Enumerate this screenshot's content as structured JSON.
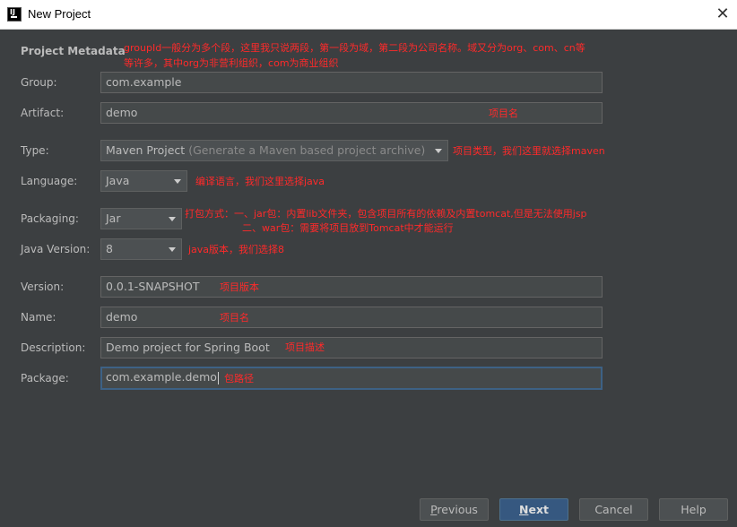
{
  "window": {
    "title": "New Project",
    "close_glyph": "✕"
  },
  "section_title": "Project Metadata",
  "fields": {
    "group": {
      "label": "Group:",
      "value": "com.example"
    },
    "artifact": {
      "label": "Artifact:",
      "value": "demo"
    },
    "type": {
      "label": "Type:",
      "value": "Maven Project",
      "hint": "(Generate a Maven based project archive)"
    },
    "language": {
      "label": "Language:",
      "value": "Java"
    },
    "packaging": {
      "label": "Packaging:",
      "value": "Jar"
    },
    "java_version": {
      "label": "Java Version:",
      "value": "8"
    },
    "version": {
      "label": "Version:",
      "value": "0.0.1-SNAPSHOT"
    },
    "name": {
      "label": "Name:",
      "value": "demo"
    },
    "description": {
      "label": "Description:",
      "value": "Demo project for Spring Boot"
    },
    "package": {
      "label": "Package:",
      "value": "com.example.demo"
    }
  },
  "annotations": {
    "group_line1": "groupId一般分为多个段，这里我只说两段，第一段为域，第二段为公司名称。域又分为org、com、cn等",
    "group_line2": "等许多，其中org为非营利组织，com为商业组织",
    "artifact": "项目名",
    "type": "项目类型，我们这里就选择maven",
    "language": "编译语言，我们这里选择java",
    "packaging_line1": "打包方式：一、jar包：内置lib文件夹，包含项目所有的依赖及内置tomcat,但是无法使用jsp",
    "packaging_line2": "二、war包：需要将项目放到Tomcat中才能运行",
    "java_version": "java版本，我们选择8",
    "version": "项目版本",
    "name": "项目名",
    "description": "项目描述",
    "package": "包路径"
  },
  "buttons": {
    "previous": {
      "first": "P",
      "rest": "revious"
    },
    "next": {
      "first": "N",
      "rest": "ext"
    },
    "cancel": "Cancel",
    "help": "Help"
  },
  "colors": {
    "background": "#3c3f41",
    "field": "#45494a",
    "annotation": "#ff2a2a",
    "primary_button": "#365880"
  }
}
